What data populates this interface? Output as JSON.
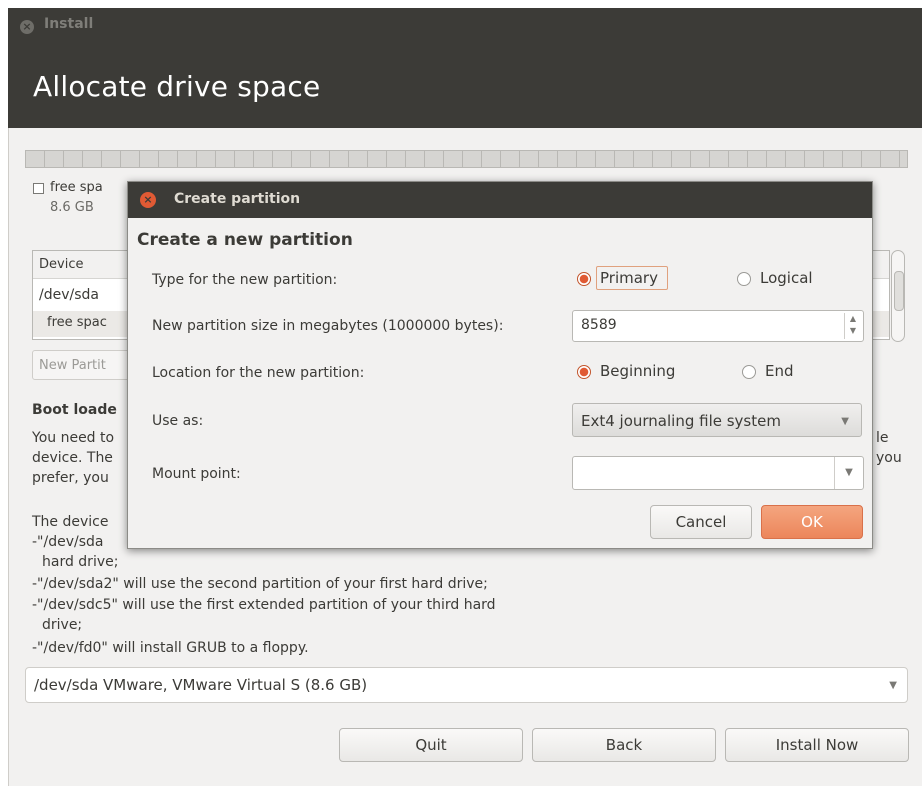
{
  "window": {
    "title": "Install",
    "heading": "Allocate drive space"
  },
  "partition_legend": {
    "label": "free spa",
    "size": "8.6 GB"
  },
  "table": {
    "header": "Device",
    "row1": "/dev/sda",
    "row2": "free spac"
  },
  "new_partition_button": "New Partit",
  "boot": {
    "title": "Boot loade",
    "para1": [
      "You need to",
      "device. The",
      "prefer, you"
    ],
    "para1_right": [
      "le",
      "you"
    ],
    "device_intro": "The device",
    "list": [
      "-\"/dev/sda",
      "hard drive;",
      "-\"/dev/sda2\" will use the second partition of your first hard drive;",
      "-\"/dev/sdc5\" will use the first extended partition of your third hard",
      "drive;",
      "-\"/dev/fd0\" will install GRUB to a floppy."
    ]
  },
  "device_select": {
    "value": "/dev/sda VMware, VMware Virtual S (8.6 GB)"
  },
  "buttons": {
    "quit": "Quit",
    "back": "Back",
    "install": "Install Now"
  },
  "dialog": {
    "title": "Create partition",
    "heading": "Create a new partition",
    "type_label": "Type for the new partition:",
    "type_primary": "Primary",
    "type_logical": "Logical",
    "size_label": "New partition size in megabytes (1000000 bytes):",
    "size_value": "8589",
    "location_label": "Location for the new partition:",
    "location_beginning": "Beginning",
    "location_end": "End",
    "use_as_label": "Use as:",
    "use_as_value": "Ext4 journaling file system",
    "mount_label": "Mount point:",
    "mount_value": "",
    "cancel": "Cancel",
    "ok": "OK"
  },
  "colors": {
    "header_bg": "#3c3b37",
    "window_bg": "#f2f1f0",
    "accent_orange": "#e05a34",
    "ok_button": "#ec865b"
  },
  "icons": {
    "window_close": "close-icon",
    "dialog_close": "close-icon",
    "dropdown": "chevron-down-icon",
    "spin": "spin-arrows-icon"
  }
}
